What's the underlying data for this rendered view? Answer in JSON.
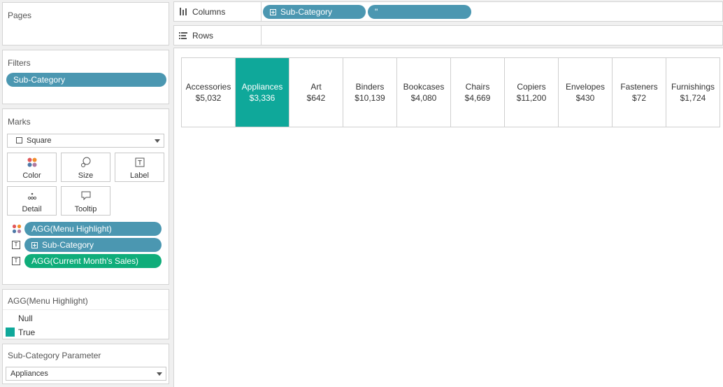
{
  "pages": {
    "title": "Pages"
  },
  "filters": {
    "title": "Filters",
    "pill": "Sub-Category"
  },
  "marks": {
    "title": "Marks",
    "mark_type": "Square",
    "buttons": [
      "Color",
      "Size",
      "Label",
      "Detail",
      "Tooltip"
    ],
    "fields": [
      {
        "type": "color",
        "label": "AGG(Menu Highlight)"
      },
      {
        "type": "label",
        "label": "Sub-Category"
      },
      {
        "type": "label",
        "label": "AGG(Current Month's Sales)"
      }
    ]
  },
  "legend": {
    "title": "AGG(Menu Highlight)",
    "items": [
      {
        "label": "Null",
        "color": ""
      },
      {
        "label": "True",
        "color": "#0fa89a"
      }
    ]
  },
  "parameter": {
    "title": "Sub-Category Parameter",
    "value": "Appliances"
  },
  "shelves": {
    "columns_label": "Columns",
    "rows_label": "Rows",
    "column_pills": [
      "Sub-Category",
      "\""
    ]
  },
  "view": {
    "highlight_color": "#0fa89a",
    "cells": [
      {
        "category": "Accessories",
        "sales": "$5,032",
        "highlighted": false
      },
      {
        "category": "Appliances",
        "sales": "$3,336",
        "highlighted": true
      },
      {
        "category": "Art",
        "sales": "$642",
        "highlighted": false
      },
      {
        "category": "Binders",
        "sales": "$10,139",
        "highlighted": false
      },
      {
        "category": "Bookcases",
        "sales": "$4,080",
        "highlighted": false
      },
      {
        "category": "Chairs",
        "sales": "$4,669",
        "highlighted": false
      },
      {
        "category": "Copiers",
        "sales": "$11,200",
        "highlighted": false
      },
      {
        "category": "Envelopes",
        "sales": "$430",
        "highlighted": false
      },
      {
        "category": "Fasteners",
        "sales": "$72",
        "highlighted": false
      },
      {
        "category": "Furnishings",
        "sales": "$1,724",
        "highlighted": false
      }
    ]
  }
}
